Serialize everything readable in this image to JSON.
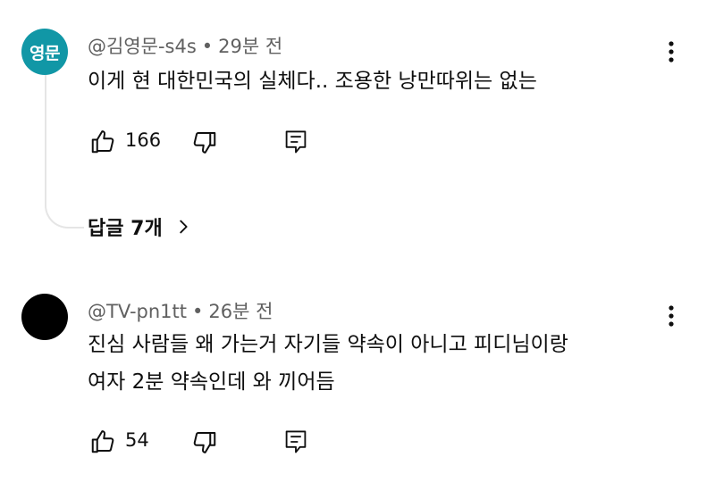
{
  "comments": [
    {
      "avatar_text": "영문",
      "avatar_color": "#1197a6",
      "author": "@김영문-s4s",
      "separator": "•",
      "time": "29분 전",
      "lines": [
        "이게 현 대한민국의 실체다.. 조용한 낭만따위는 없는"
      ],
      "likes": "166",
      "replies_label": "답글 7개"
    },
    {
      "avatar_text": "",
      "avatar_color": "#000000",
      "author": "@TV-pn1tt",
      "separator": "•",
      "time": "26분 전",
      "lines": [
        "진심 사람들 왜 가는거 자기들 약속이 아니고 피디님이랑",
        "여자 2분 약속인데 와 끼어듬"
      ],
      "likes": "54"
    }
  ],
  "icons": {
    "like": "thumbs-up-icon",
    "dislike": "thumbs-down-icon",
    "reply": "reply-icon",
    "menu": "more-vertical-icon",
    "chevron": "chevron-right-icon"
  }
}
